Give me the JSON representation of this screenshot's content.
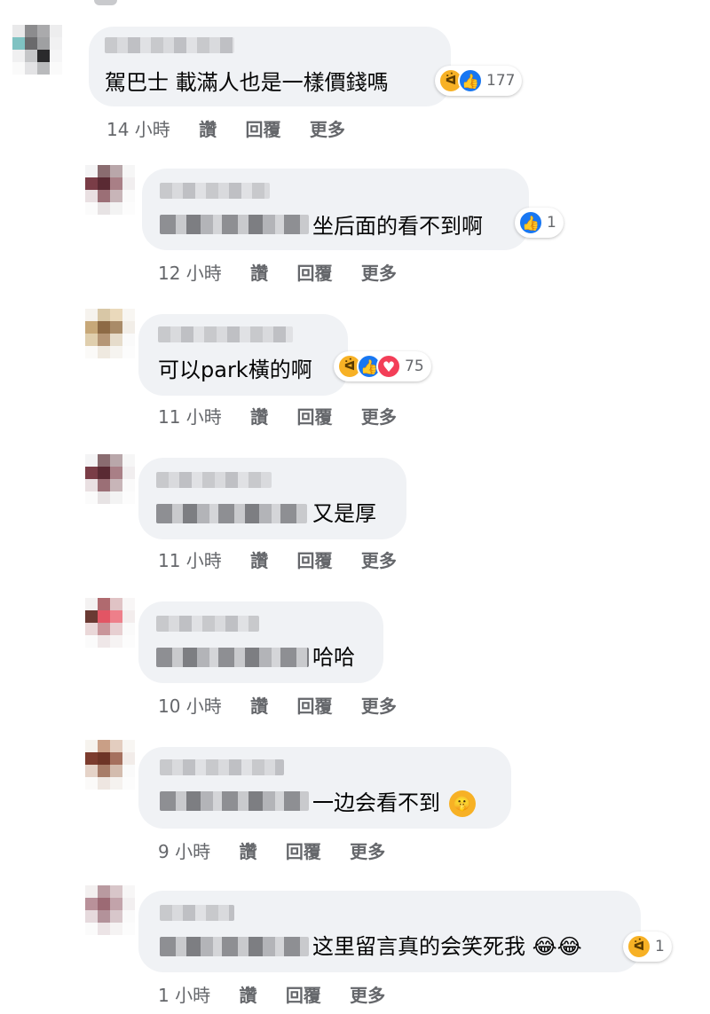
{
  "comments": [
    {
      "text": "駕巴士 載滿人也是一樣價錢嗎",
      "time": "14 小時",
      "like": "讚",
      "reply": "回覆",
      "more": "更多",
      "reactions": [
        "haha",
        "like"
      ],
      "reaction_count": "177"
    },
    {
      "text": "坐后面的看不到啊",
      "time": "12 小時",
      "like": "讚",
      "reply": "回覆",
      "more": "更多",
      "reactions": [
        "like"
      ],
      "reaction_count": "1"
    },
    {
      "text": "可以park橫的啊",
      "time": "11 小時",
      "like": "讚",
      "reply": "回覆",
      "more": "更多",
      "reactions": [
        "haha",
        "like",
        "love"
      ],
      "reaction_count": "75"
    },
    {
      "text": "又是厚",
      "time": "11 小時",
      "like": "讚",
      "reply": "回覆",
      "more": "更多"
    },
    {
      "text": "哈哈",
      "time": "10 小時",
      "like": "讚",
      "reply": "回覆",
      "more": "更多"
    },
    {
      "text": "一边会看不到",
      "time": "9 小時",
      "like": "讚",
      "reply": "回覆",
      "more": "更多",
      "inline_emoji": "🤫"
    },
    {
      "text": "这里留言真的会笑死我",
      "time": "1 小時",
      "like": "讚",
      "reply": "回覆",
      "more": "更多",
      "inline_emoji": "😂😂",
      "reactions": [
        "haha"
      ],
      "reaction_count": "1"
    }
  ],
  "colors": {
    "bubble": "#f0f2f5",
    "meta_text": "#65676b",
    "like_blue": "#1877f2",
    "haha_yellow": "#f7b125",
    "love_red": "#f33e58"
  }
}
